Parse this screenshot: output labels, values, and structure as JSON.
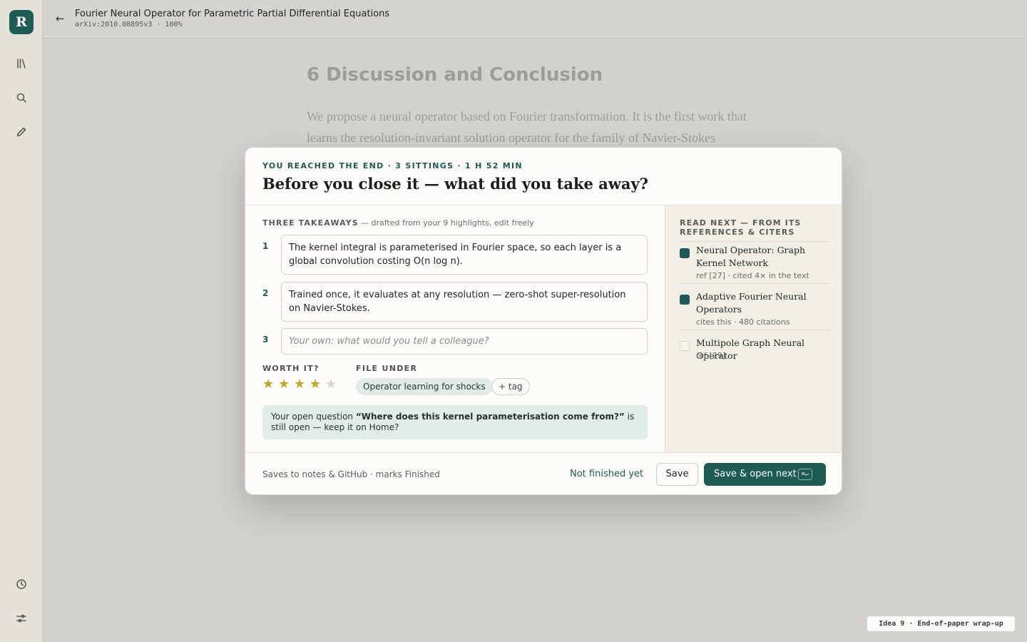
{
  "app": {
    "logo_letter": "R",
    "accent_color": "#1d5c52"
  },
  "sidebar": {
    "icons": [
      "library-icon",
      "search-icon",
      "pencil-icon",
      "clock-icon",
      "sliders-icon"
    ]
  },
  "header": {
    "back_glyph": "←",
    "title": "Fourier Neural Operator for Parametric Partial Differential Equations",
    "subtitle": "arXiv:2010.08895v3 · 100%"
  },
  "paper": {
    "heading": "6 Discussion and Conclusion",
    "text": "We propose a neural operator based on Fourier transformation. It is the first work that learns the resolution-invariant solution operator for the family of Navier-Stokes"
  },
  "modal": {
    "eyebrow": "YOU REACHED THE END · 3 SITTINGS · 1 H 52 MIN",
    "title": "Before you close it — what did you take away?",
    "takeaways_label": "THREE TAKEAWAYS",
    "takeaways_note": "— drafted from your 9 highlights, edit freely",
    "takeaways": [
      {
        "num": "1",
        "text": "The kernel integral is parameterised in Fourier space, so each layer is a global convolution costing O(n log n)."
      },
      {
        "num": "2",
        "text": "Trained once, it evaluates at any resolution — zero-shot super-resolution on Navier-Stokes."
      },
      {
        "num": "3",
        "text": "",
        "placeholder": "Your own: what would you tell a colleague?"
      }
    ],
    "worth_label": "WORTH IT?",
    "rating": 4,
    "rating_max": 5,
    "file_label": "FILE UNDER",
    "file_tag": "Operator learning for shocks",
    "add_tag_label": "+ tag",
    "notice": {
      "prefix": "Your open question ",
      "question": "“Where does this kernel parameterisation come from?”",
      "suffix": " is still open — keep it on Home?"
    },
    "read_next_label": "READ NEXT — FROM ITS REFERENCES & CITERS",
    "read_next": [
      {
        "title": "Neural Operator: Graph Kernel Network",
        "meta": "ref [27] · cited 4× in the text",
        "checked": true
      },
      {
        "title": "Adaptive Fourier Neural Operators",
        "meta": "cites this · 480 citations",
        "checked": true
      },
      {
        "title": "Multipole Graph Neural Operator",
        "meta": "ref [29]",
        "checked": false
      }
    ],
    "footer_note": "Saves to notes & GitHub · marks Finished",
    "not_finished_label": "Not finished yet",
    "save_label": "Save",
    "save_open_label": "Save & open next",
    "shortcut": "⌘↵"
  },
  "corner_label": "Idea 9 · End-of-paper wrap-up"
}
